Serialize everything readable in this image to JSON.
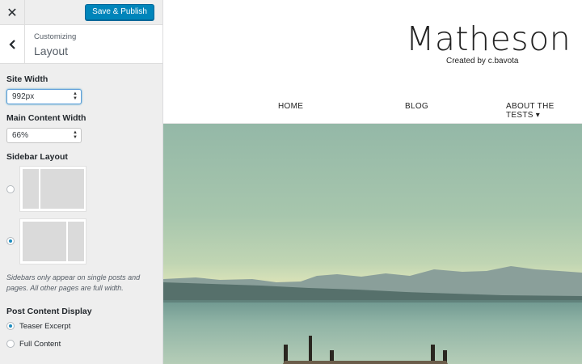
{
  "customizer": {
    "close_icon": "close-icon",
    "save_label": "Save & Publish",
    "accent_color": "#0085ba",
    "section": {
      "subtitle": "Customizing",
      "title": "Layout",
      "back_icon": "chevron-left-icon"
    },
    "controls": {
      "site_width": {
        "label": "Site Width",
        "value": "992px"
      },
      "main_content_width": {
        "label": "Main Content Width",
        "value": "66%"
      },
      "sidebar_layout": {
        "label": "Sidebar Layout",
        "options": [
          {
            "name": "sidebar-left",
            "checked": false
          },
          {
            "name": "sidebar-right",
            "checked": true
          }
        ],
        "note": "Sidebars only appear on single posts and pages. All other pages are full width."
      },
      "post_content_display": {
        "label": "Post Content Display",
        "options": [
          {
            "label": "Teaser Excerpt",
            "checked": true
          },
          {
            "label": "Full Content",
            "checked": false
          }
        ]
      }
    }
  },
  "preview": {
    "site_title": "Matheson",
    "tagline": "Created by c.bavota",
    "nav": [
      {
        "label": "HOME"
      },
      {
        "label": "BLOG"
      },
      {
        "label": "ABOUT THE TESTS ▾"
      }
    ],
    "hero_image": "lake-pier-photo"
  }
}
